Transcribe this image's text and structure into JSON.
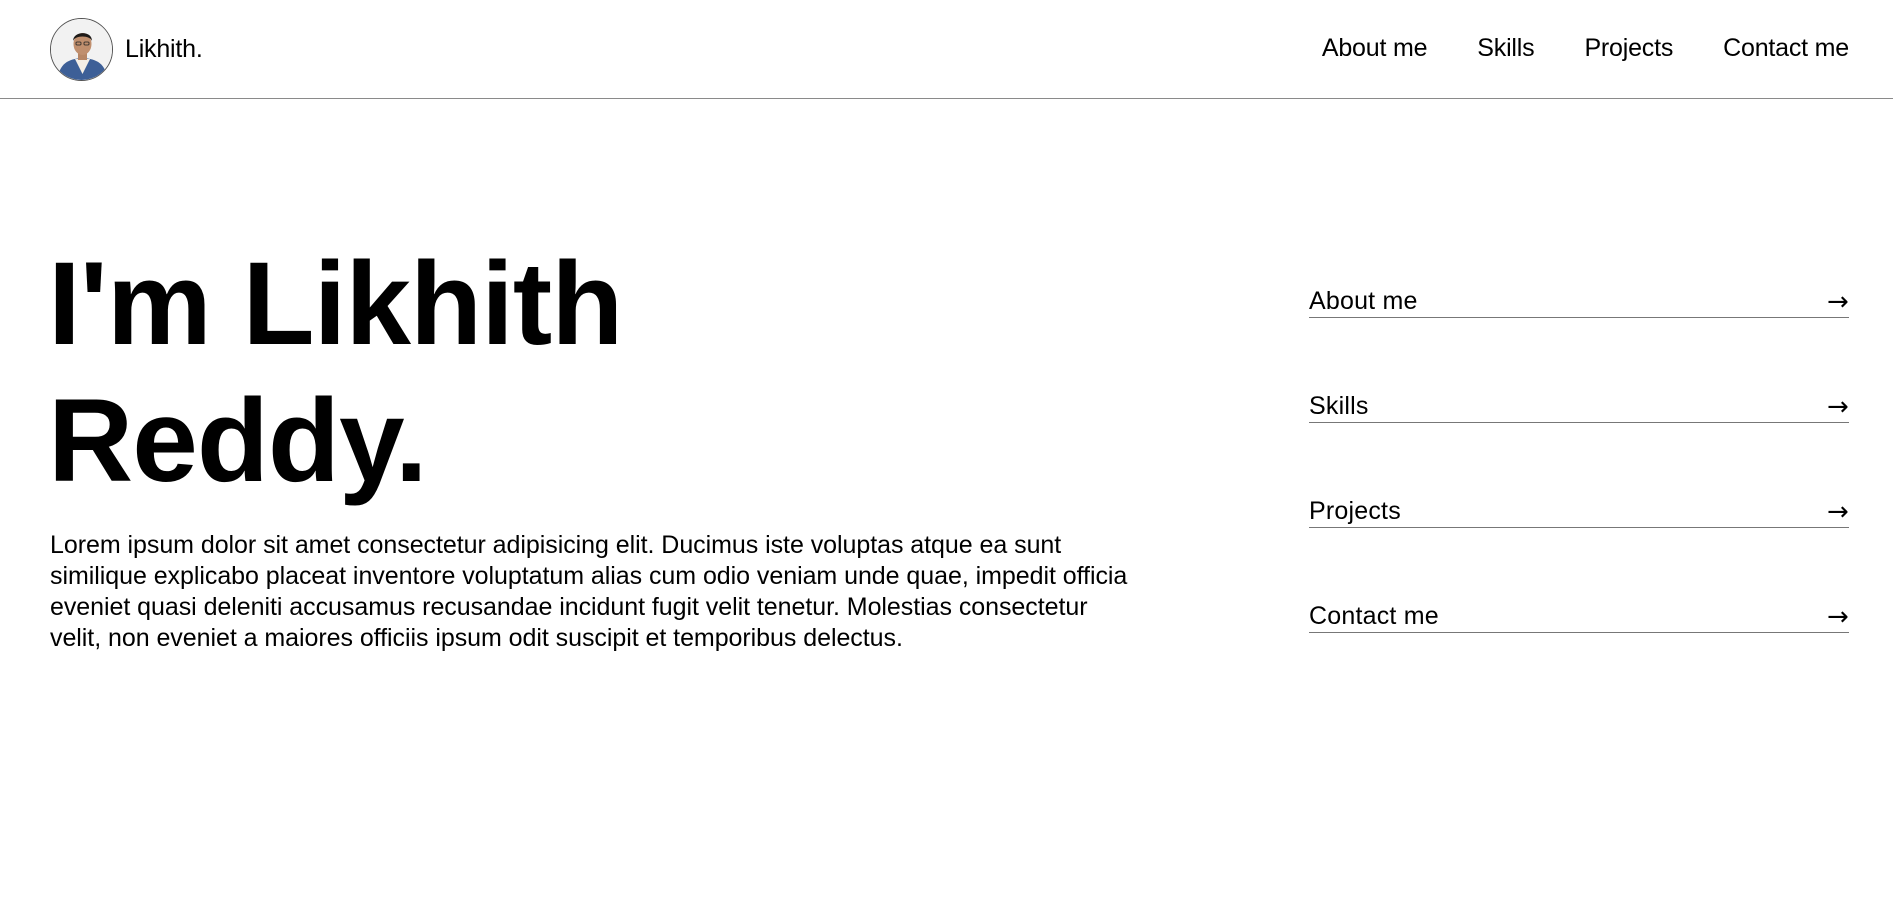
{
  "header": {
    "brand_name": "Likhith.",
    "nav": [
      "About me",
      "Skills",
      "Projects",
      "Contact me"
    ]
  },
  "hero": {
    "title_line1": "I'm Likhith",
    "title_line2": "Reddy.",
    "description": "Lorem ipsum dolor sit amet consectetur adipisicing elit. Ducimus iste voluptas atque ea sunt similique explicabo placeat inventore voluptatum alias cum odio veniam unde quae, impedit officia eveniet quasi deleniti accusamus recusandae incidunt fugit velit tenetur. Molestias consectetur velit, non eveniet a maiores officiis ipsum odit suscipit et temporibus delectus."
  },
  "sidenav": {
    "items": [
      {
        "label": "About me",
        "arrow": "→"
      },
      {
        "label": "Skills",
        "arrow": "→"
      },
      {
        "label": "Projects",
        "arrow": "→"
      },
      {
        "label": "Contact me",
        "arrow": "→"
      }
    ]
  },
  "colors": {
    "text": "#000000",
    "background": "#ffffff",
    "divider": "#8a8a8a"
  }
}
